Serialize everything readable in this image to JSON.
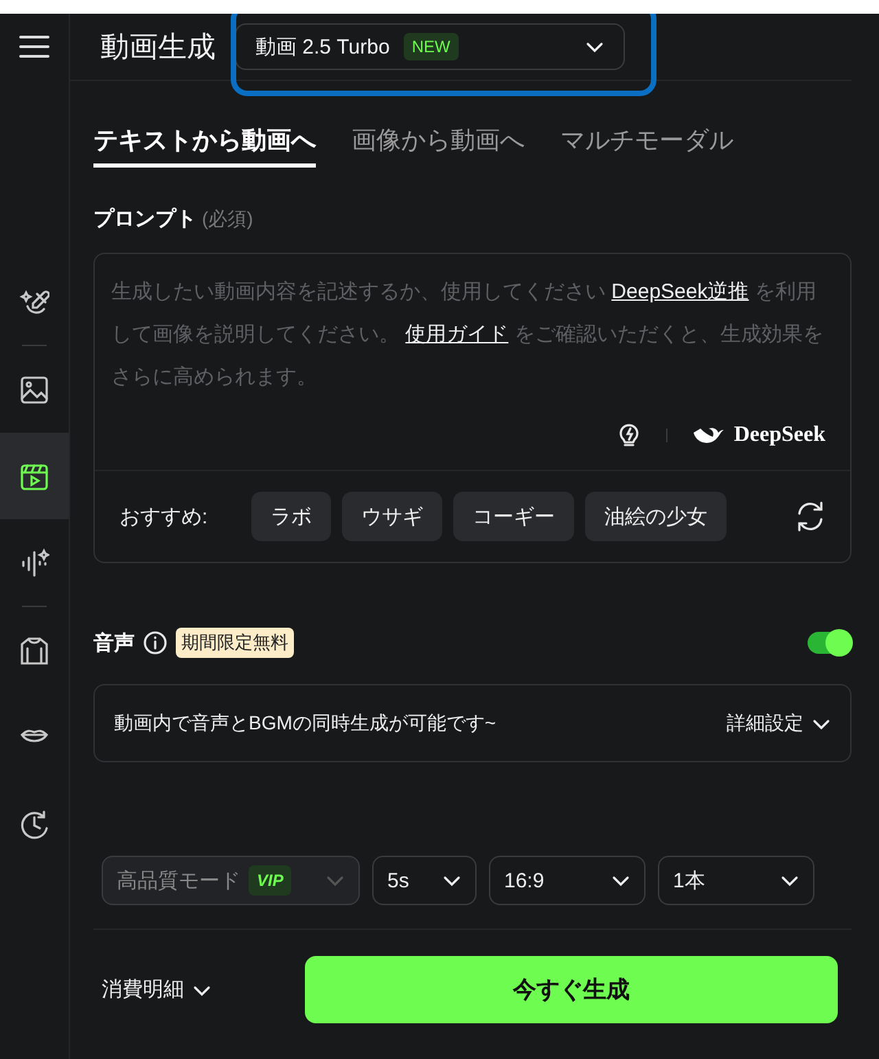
{
  "header": {
    "title": "動画生成",
    "model_selector": {
      "value": "動画 2.5 Turbo",
      "badge": "NEW",
      "highlighted": true
    }
  },
  "sidebar": {
    "items": [
      {
        "kind": "item",
        "selected": false
      },
      {
        "kind": "divider"
      },
      {
        "kind": "item",
        "selected": false
      },
      {
        "kind": "item",
        "selected": true
      },
      {
        "kind": "item",
        "selected": false
      },
      {
        "kind": "divider"
      },
      {
        "kind": "item",
        "selected": false
      },
      {
        "kind": "item",
        "selected": false
      },
      {
        "kind": "item",
        "selected": false
      }
    ]
  },
  "tabs": [
    {
      "label": "テキストから動画へ",
      "selected": true
    },
    {
      "label": "画像から動画へ",
      "selected": false
    },
    {
      "label": "マルチモーダル",
      "selected": false
    }
  ],
  "prompt": {
    "label": "プロンプト",
    "note": "(必須)",
    "placeholder": [
      {
        "kind": "text",
        "text": "生成したい動画内容を記述するか、使用してください "
      },
      {
        "kind": "link",
        "text": "DeepSeek逆推"
      },
      {
        "kind": "text",
        "text": " を利用して画像を説明してください。 "
      },
      {
        "kind": "link",
        "text": "使用ガイド"
      },
      {
        "kind": "text",
        "text": " をご確認いただくと、生成効果をさらに高められます。"
      }
    ],
    "brand": "DeepSeek",
    "suggestions_label": "おすすめ:",
    "suggestions": [
      "ラボ",
      "ウサギ",
      "コーギー",
      "油絵の少女"
    ]
  },
  "audio": {
    "label": "音声",
    "badge": "期間限定無料",
    "on": true,
    "description": "動画内で音声とBGMの同時生成が可能です~",
    "details": "詳細設定"
  },
  "options": [
    {
      "value": "高品質モード",
      "badge": "VIP",
      "disabled": true
    },
    {
      "value": "5s",
      "disabled": false
    },
    {
      "value": "16:9",
      "disabled": false
    },
    {
      "value": "1本",
      "disabled": false
    }
  ],
  "footer": {
    "cost": "消費明細",
    "generate": "今すぐ生成"
  }
}
